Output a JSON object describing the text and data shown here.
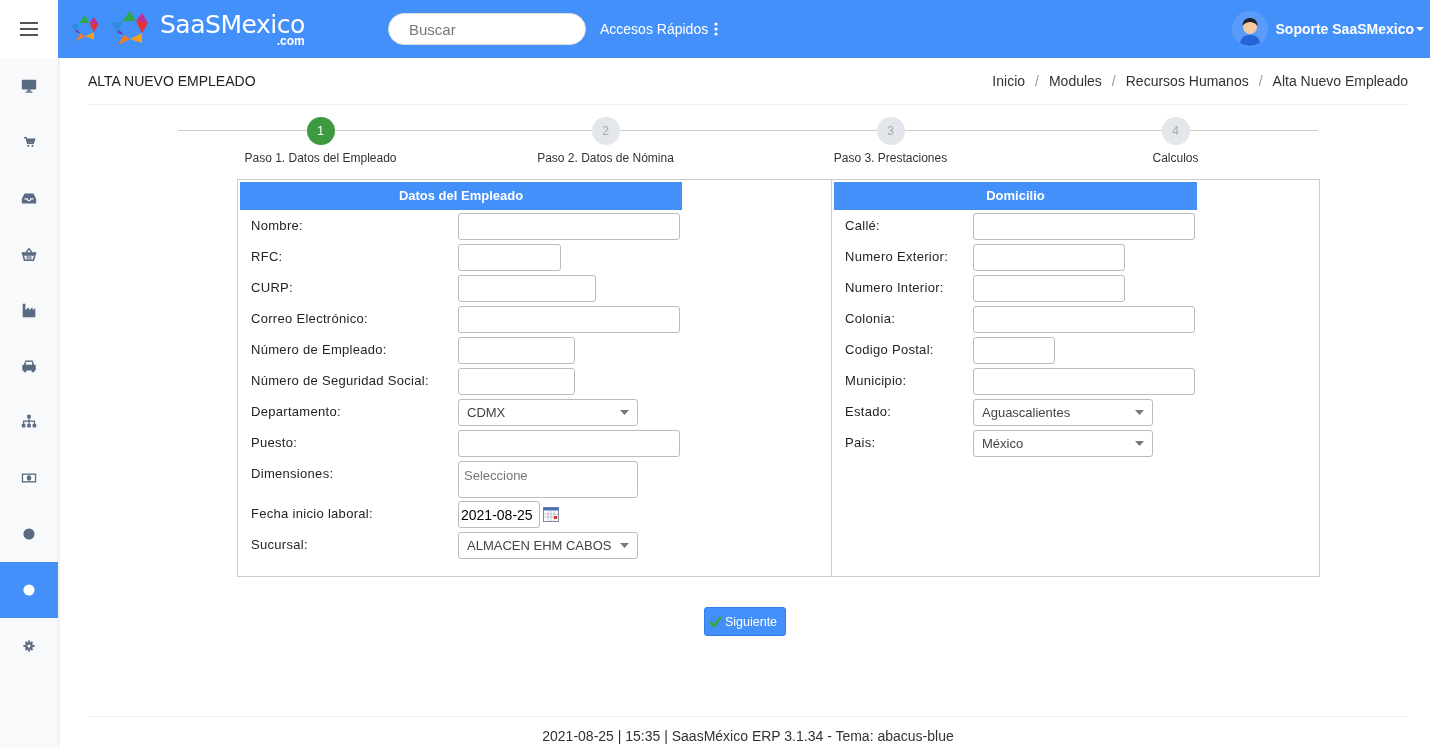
{
  "topbar": {
    "logo": {
      "name": "SaaSMexico",
      "suffix": ".com"
    },
    "search": {
      "placeholder": "Buscar"
    },
    "quick_access": "Accesos Rápidos",
    "user": "Soporte SaaSMexico"
  },
  "sidebar": {
    "items": [
      {
        "kind": "monitor",
        "selected": false
      },
      {
        "kind": "cart",
        "selected": false
      },
      {
        "kind": "inbox",
        "selected": false
      },
      {
        "kind": "basket",
        "selected": false
      },
      {
        "kind": "factory",
        "selected": false
      },
      {
        "kind": "car",
        "selected": false
      },
      {
        "kind": "sitemap",
        "selected": false
      },
      {
        "kind": "money",
        "selected": false
      },
      {
        "kind": "circle",
        "selected": false
      },
      {
        "kind": "circle",
        "selected": true
      },
      {
        "kind": "gear",
        "selected": false
      }
    ]
  },
  "page_title": "ALTA NUEVO EMPLEADO",
  "breadcrumb": {
    "separator": "/",
    "items": [
      "Inicio",
      "Modules",
      "Recursos Humanos",
      "Alta Nuevo Empleado"
    ]
  },
  "steps": [
    {
      "number": "1",
      "label": "Paso 1. Datos del Empleado",
      "selected": true
    },
    {
      "number": "2",
      "label": "Paso 2. Datos de Nómina",
      "selected": false
    },
    {
      "number": "3",
      "label": "Paso 3. Prestaciones",
      "selected": false
    },
    {
      "number": "4",
      "label": "Calculos",
      "selected": false
    }
  ],
  "panels": [
    {
      "title": "Datos del Empleado",
      "fields": [
        {
          "label": "Nombre:",
          "kind": "text"
        },
        {
          "label": "RFC:",
          "kind": "text"
        },
        {
          "label": "CURP:",
          "kind": "text"
        },
        {
          "label": "Correo Electrónico:",
          "kind": "text"
        },
        {
          "label": "Número de Empleado:",
          "kind": "text"
        },
        {
          "label": "Número de Seguridad Social:",
          "kind": "text"
        },
        {
          "label": "Departamento:",
          "kind": "select",
          "value": "CDMX"
        },
        {
          "label": "Puesto:",
          "kind": "text"
        },
        {
          "label": "Dimensiones:",
          "kind": "textarea",
          "placeholder": "Seleccione"
        },
        {
          "label": "Fecha inicio laboral:",
          "kind": "date",
          "value": "2021-08-25"
        },
        {
          "label": "Sucursal:",
          "kind": "select",
          "value": "ALMACEN EHM CABOS"
        }
      ]
    },
    {
      "title": "Domicilio",
      "fields": [
        {
          "label": "Callé:",
          "kind": "text"
        },
        {
          "label": "Numero Exterior:",
          "kind": "text"
        },
        {
          "label": "Numero Interior:",
          "kind": "text"
        },
        {
          "label": "Colonia:",
          "kind": "text"
        },
        {
          "label": "Codigo Postal:",
          "kind": "text"
        },
        {
          "label": "Municipio:",
          "kind": "text"
        },
        {
          "label": "Estado:",
          "kind": "select",
          "value": "Aguascalientes"
        },
        {
          "label": "Pais:",
          "kind": "select",
          "value": "México"
        }
      ]
    }
  ],
  "next_button": "Siguiente",
  "footer": "2021-08-25 | 15:35 | SaasMéxico ERP 3.1.34 - Tema: abacus-blue"
}
